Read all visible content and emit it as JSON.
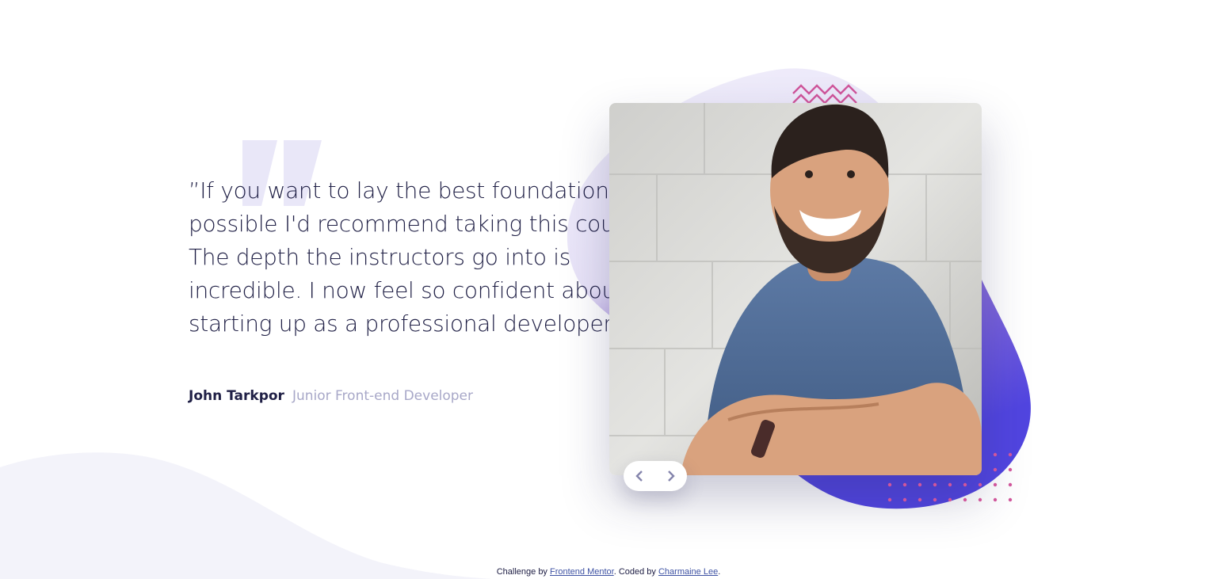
{
  "testimonial": {
    "quote": "”If you want to lay the best foundation possible I'd recommend taking this course. The depth the instructors go into is incredible. I now feel so confident about starting up as a professional developer. ”",
    "author_name": "John Tarkpor",
    "author_role": "Junior Front-end Developer"
  },
  "navigation": {
    "prev_icon": "chevron-left-icon",
    "next_icon": "chevron-right-icon"
  },
  "footer": {
    "prefix": "Challenge by ",
    "challenge_link": "Frontend Mentor",
    "middle": ". Coded by ",
    "author_link": "Charmaine Lee",
    "suffix": "."
  },
  "colors": {
    "text_dark": "#202046",
    "text_muted": "#a8a8c8",
    "accent_purple": "#8d6bd4",
    "accent_blue": "#5b4de0",
    "accent_pink": "#d0569b",
    "background_curve": "#f3f3fa"
  }
}
